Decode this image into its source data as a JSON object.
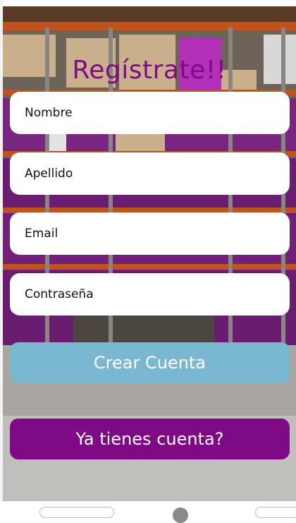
{
  "page": {
    "title": "Regístrate!!"
  },
  "form": {
    "fields": [
      {
        "name": "nombre",
        "placeholder": "Nombre"
      },
      {
        "name": "apellido",
        "placeholder": "Apellido"
      },
      {
        "name": "email",
        "placeholder": "Email"
      },
      {
        "name": "password",
        "placeholder": "Contraseña"
      }
    ],
    "create_label": "Crear Cuenta",
    "login_label": "Ya tienes cuenta?"
  },
  "colors": {
    "brand": "#7e0a86",
    "create_button": "#7ab7d0"
  }
}
